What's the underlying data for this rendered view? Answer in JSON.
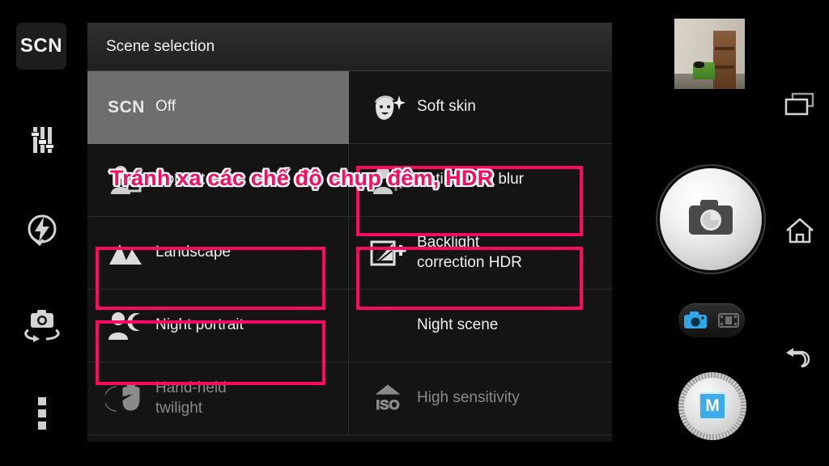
{
  "app": {
    "name": "Camera",
    "accent_pink": "#ff0a5e",
    "accent_blue": "#3daaea",
    "panel_bg": "#141414",
    "selected_row_bg": "#6e6e6e"
  },
  "sidebar": {
    "items": [
      {
        "label": "SCN",
        "icon": "scn-icon",
        "name": "sidebar-scene-mode",
        "selected": true
      },
      {
        "label": "",
        "icon": "sliders-icon",
        "name": "sidebar-settings-sliders",
        "selected": false
      },
      {
        "label": "",
        "icon": "flash-auto-icon",
        "name": "sidebar-flash",
        "selected": false
      },
      {
        "label": "",
        "icon": "switch-camera-icon",
        "name": "sidebar-switch-camera",
        "selected": false
      },
      {
        "label": "",
        "icon": "more-options-icon",
        "name": "sidebar-more-options",
        "selected": false
      }
    ]
  },
  "panel": {
    "title": "Scene selection",
    "rows": [
      {
        "left": {
          "label": "Off",
          "sub": "",
          "icon": "scn-icon",
          "selected": true,
          "dim": false,
          "highlighted": false
        },
        "right": {
          "label": "Soft skin",
          "sub": "",
          "icon": "soft-skin-icon",
          "selected": false,
          "dim": false,
          "highlighted": false
        }
      },
      {
        "left": {
          "label": "Portrait",
          "sub": "",
          "icon": "portrait-icon",
          "selected": false,
          "dim": false,
          "highlighted": false
        },
        "right": {
          "label": "Anti motion blur",
          "sub": "",
          "icon": "anti-blur-icon",
          "selected": false,
          "dim": false,
          "highlighted": false
        }
      },
      {
        "left": {
          "label": "Landscape",
          "sub": "",
          "icon": "landscape-icon",
          "selected": false,
          "dim": false,
          "highlighted": false
        },
        "right": {
          "label": "Backlight",
          "sub": "correction HDR",
          "icon": "backlight-hdr-icon",
          "selected": false,
          "dim": false,
          "highlighted": true
        }
      },
      {
        "left": {
          "label": "Night portrait",
          "sub": "",
          "icon": "night-portrait-icon",
          "selected": false,
          "dim": false,
          "highlighted": true
        },
        "right": {
          "label": "Night scene",
          "sub": "",
          "icon": "moon-icon",
          "selected": false,
          "dim": false,
          "highlighted": true
        }
      },
      {
        "left": {
          "label": "Hand-held",
          "sub": "twilight",
          "icon": "handheld-twilight-icon",
          "selected": false,
          "dim": true,
          "highlighted": true
        },
        "right": {
          "label": "High sensitivity",
          "sub": "",
          "icon": "iso-icon",
          "selected": false,
          "dim": true,
          "highlighted": false
        }
      }
    ]
  },
  "annotation": {
    "caption": "Tránh xa các chế độ chụp đêm, HDR",
    "color": "#ff0a5e",
    "outline": "#ffffff"
  },
  "right_controls": {
    "thumbnail_name": "last-photo-thumbnail",
    "recents_icon": "recents-icon",
    "home_icon": "home-icon",
    "back_icon": "back-icon",
    "shutter_icon": "camera-shutter-icon",
    "mode_toggle": {
      "photo_icon": "photo-mode-icon",
      "video_icon": "video-mode-icon",
      "active": "photo"
    },
    "mode_dial_label": "M"
  }
}
